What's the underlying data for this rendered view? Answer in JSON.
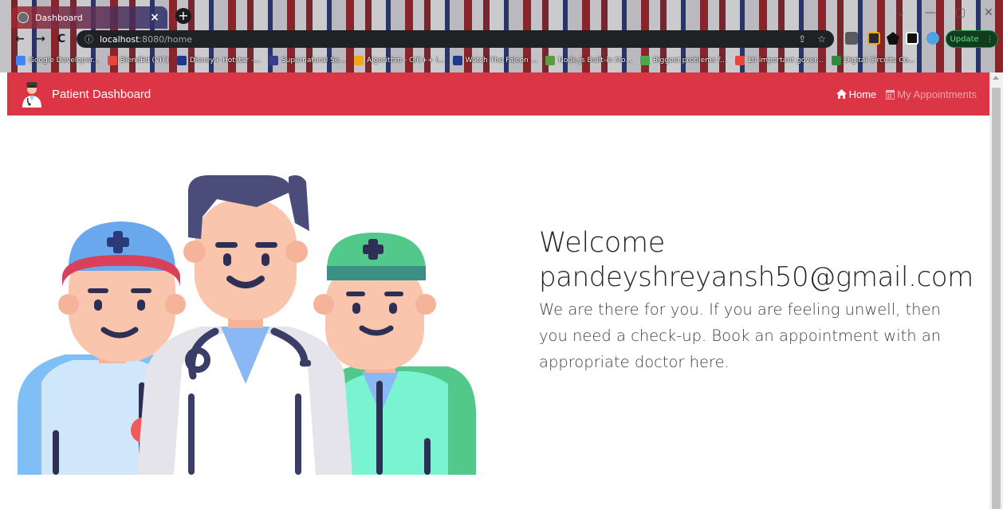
{
  "browser": {
    "tab_title": "Dashboard",
    "tab_close": "×",
    "new_tab": "+",
    "url_host": "localhost",
    "url_path": ":8080/home",
    "update_label": "Update",
    "bookmarks": [
      {
        "label": "Google Developer...",
        "color": "#4285f4"
      },
      {
        "label": "BlendEd (VIT)",
        "color": "#e8453c"
      },
      {
        "label": "Disney+ Hotstar -...",
        "color": "#1f3a8c"
      },
      {
        "label": "Supernatural Se...",
        "color": "#3c3c8c"
      },
      {
        "label": "Algorithm - C/C++ i...",
        "color": "#f2a516"
      },
      {
        "label": "Watch The Falcon ...",
        "color": "#1f3a8c"
      },
      {
        "label": "Node.js Built-in Mo...",
        "color": "#5a9e3a"
      },
      {
        "label": "Biggest problems f...",
        "color": "#4aa84a"
      },
      {
        "label": "10 important gover...",
        "color": "#e8453c"
      },
      {
        "label": "Digital Circuits Co...",
        "color": "#2e8b3a"
      }
    ]
  },
  "navbar": {
    "brand": "Patient Dashboard",
    "links": [
      {
        "label": "Home",
        "icon": "home-icon",
        "active": true
      },
      {
        "label": "My Appointments",
        "icon": "calendar-icon",
        "active": false
      }
    ],
    "color": "#dc3545"
  },
  "hero": {
    "welcome": "Welcome",
    "email": "pandeyshreyansh50@gmail.com",
    "description": "We are there for you. If you are feeling unwell, then you need a check-up. Book an appointment with an appropriate doctor here."
  }
}
